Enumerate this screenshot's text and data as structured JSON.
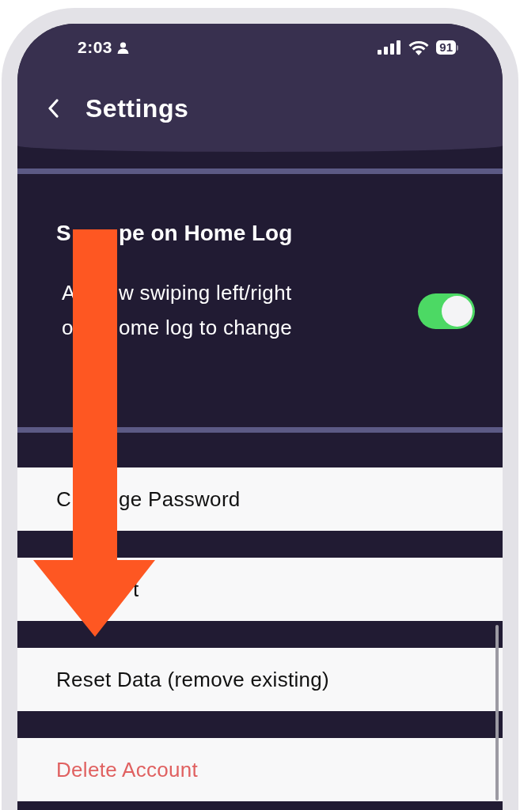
{
  "status_bar": {
    "time": "2:03",
    "battery": "91"
  },
  "header": {
    "title": "Settings"
  },
  "setting": {
    "title": {
      "lead": "S",
      "text": "pe on Home Log"
    },
    "description": [
      {
        "lead": "A",
        "text": "w swiping left/right"
      },
      {
        "lead": "o",
        "text": "ome log to change"
      }
    ],
    "on": true
  },
  "rows": [
    {
      "lead": "C",
      "text": "ge Password",
      "kind": "normal"
    },
    {
      "text": "t",
      "kind": "normal",
      "covered": true
    },
    {
      "text": "Reset Data (remove existing)",
      "kind": "normal"
    },
    {
      "text": "Delete Account",
      "kind": "danger"
    }
  ]
}
